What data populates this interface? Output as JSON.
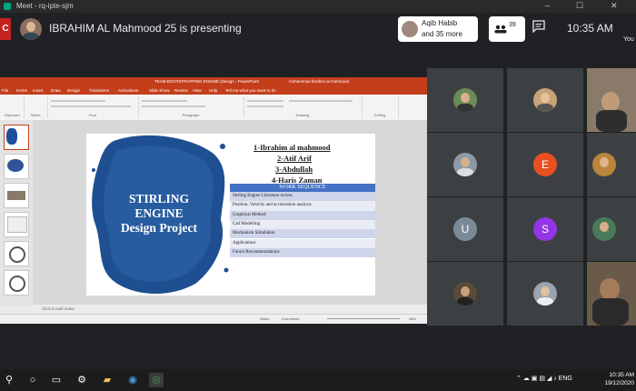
{
  "browser": {
    "tab_title": "Meet - rq-ipte-sjm",
    "controls": [
      "–",
      "☐",
      "✕"
    ]
  },
  "meet": {
    "rec_label": "C",
    "presenting_text": "IBRAHIM AL Mahmood 25 is presenting",
    "participants_chip": {
      "line1": "Aqib Habib",
      "line2": "and 35 more"
    },
    "people_count": "39",
    "time": "10:35 AM",
    "you_label": "You"
  },
  "powerpoint": {
    "window_title": "TEAM BOOTSTRAPPING ENGINE (Design - PowerPoint",
    "user": "mohammad Ibrahim al mahmood",
    "tabs": [
      "File",
      "Home",
      "Insert",
      "Draw",
      "Design",
      "Transitions",
      "Animations",
      "Slide Show",
      "Review",
      "View",
      "Help",
      "Tell me what you want to do"
    ],
    "ribbon_groups": [
      "Clipboard",
      "Slides",
      "Font",
      "Paragraph",
      "Drawing",
      "Editing"
    ],
    "notes_placeholder": "Click to add notes",
    "status": {
      "notes": "Notes",
      "comments": "Comments",
      "zoom": "48%"
    }
  },
  "slide": {
    "title_lines": [
      "STIRLING",
      "ENGINE",
      "Design Project"
    ],
    "team": [
      "1-Ibrahim al mahmood",
      "2-Atif Arif",
      "3-Abdullah",
      "4-Haris Zaman"
    ],
    "work_sequence_title": "WORK SEQUENCE",
    "work_sequence": [
      "Stirling Engine Literature review",
      "Position, Velocity and acceleration analysis",
      "Graphical Method",
      "Cad Modelling",
      "Mechanism Simulation",
      "Applications",
      "Future Recommendations"
    ]
  },
  "participants": [
    {
      "type": "photo",
      "color": "#6d8a5a"
    },
    {
      "type": "photo",
      "color": "#c8a27a"
    },
    {
      "type": "video",
      "color": "#8a7a6a"
    },
    {
      "type": "photo",
      "color": "#8c9aa8"
    },
    {
      "type": "initial",
      "initial": "E",
      "color": "#e8501f"
    },
    {
      "type": "photo",
      "color": "#b8853a"
    },
    {
      "type": "initial",
      "initial": "U",
      "color": "#7a8a99"
    },
    {
      "type": "initial",
      "initial": "S",
      "color": "#9334e6"
    },
    {
      "type": "photo",
      "color": "#4a7a5a"
    },
    {
      "type": "photo",
      "color": "#5a4a3a"
    },
    {
      "type": "photo",
      "color": "#9aa4ae"
    },
    {
      "type": "video",
      "color": "#6a5a4a"
    }
  ],
  "taskbar": {
    "language": "ENG",
    "time": "10:35 AM",
    "date": "19/12/2020"
  }
}
